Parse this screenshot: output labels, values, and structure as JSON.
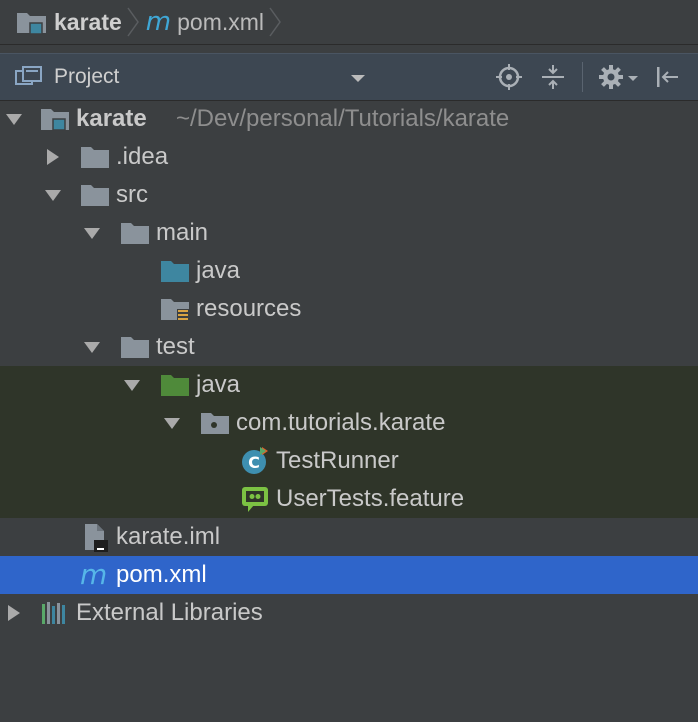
{
  "breadcrumb": {
    "items": [
      {
        "label": "karate",
        "icon": "module-folder-icon"
      },
      {
        "label": "pom.xml",
        "icon": "maven-icon"
      }
    ]
  },
  "tool_window": {
    "title": "Project",
    "buttons": [
      "locate-icon",
      "collapse-all-icon",
      "gear-icon",
      "hide-icon"
    ]
  },
  "tree": {
    "root": {
      "label": "karate",
      "path": "~/Dev/personal/Tutorials/karate"
    },
    "idea": {
      "label": ".idea"
    },
    "src": {
      "label": "src"
    },
    "main": {
      "label": "main"
    },
    "main_java": {
      "label": "java"
    },
    "resources": {
      "label": "resources"
    },
    "test": {
      "label": "test"
    },
    "test_java": {
      "label": "java"
    },
    "package": {
      "label": "com.tutorials.karate"
    },
    "test_runner": {
      "label": "TestRunner"
    },
    "user_tests": {
      "label": "UserTests.feature"
    },
    "karate_iml": {
      "label": "karate.iml"
    },
    "pom": {
      "label": "pom.xml"
    },
    "ext_libs": {
      "label": "External Libraries"
    }
  },
  "colors": {
    "background": "#3c3f41",
    "selection": "#2f65ca",
    "test_zone": "#2f3529",
    "source_folder": "#3e86a0",
    "test_folder": "#4f8a3a"
  }
}
